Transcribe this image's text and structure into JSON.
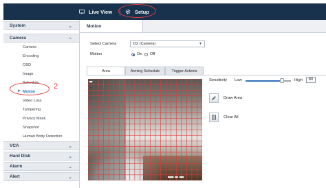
{
  "topbar": {
    "live_view_label": "Live View",
    "setup_label": "Setup",
    "background_color": "#18324e",
    "annotation_color": "#e23a3a"
  },
  "sidebar": {
    "groups": [
      {
        "label": "System",
        "expanded": false
      },
      {
        "label": "Camera",
        "expanded": true
      },
      {
        "label": "VCA",
        "expanded": false
      },
      {
        "label": "Hard Disk",
        "expanded": false
      },
      {
        "label": "Alarm",
        "expanded": false
      },
      {
        "label": "Alert",
        "expanded": false
      }
    ],
    "camera_items": [
      {
        "label": "Camera"
      },
      {
        "label": "Encoding"
      },
      {
        "label": "OSD"
      },
      {
        "label": "Image"
      },
      {
        "label": "Schedule"
      },
      {
        "label": "Motion",
        "active": true
      },
      {
        "label": "Video Loss"
      },
      {
        "label": "Tampering"
      },
      {
        "label": "Privacy Mask"
      },
      {
        "label": "Snapshot"
      },
      {
        "label": "Human Body Detection"
      }
    ],
    "annotation_number": "2"
  },
  "main": {
    "page_tab": "Motion",
    "select_camera_label": "Select Camera",
    "select_camera_value": "D2 (Camera)",
    "motion_label": "Motion",
    "motion_on_label": "On",
    "motion_off_label": "Off",
    "motion_state": "On",
    "tabs": [
      {
        "label": "Area",
        "active": true
      },
      {
        "label": "Arming Schedule",
        "active": false
      },
      {
        "label": "Trigger Actions",
        "active": false
      }
    ],
    "sensitivity_label": "Sensitivity",
    "sensitivity_low": "Low",
    "sensitivity_high": "High",
    "sensitivity_value": "80",
    "draw_area_label": "Draw Area",
    "clear_all_label": "Clear All",
    "accent_color": "#2d6fb7",
    "grid_color": "#e23a3a"
  }
}
